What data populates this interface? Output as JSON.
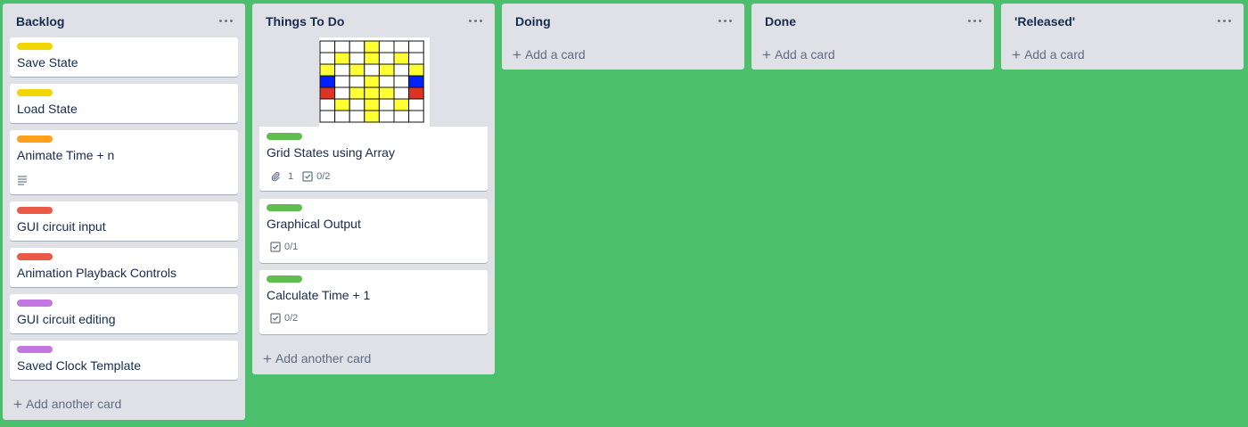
{
  "colors": {
    "board_bg": "#4bbf6b",
    "yellow": "#f2d600",
    "orange": "#ff9f1a",
    "red": "#eb5a46",
    "purple": "#c377e0",
    "green": "#61bd4f"
  },
  "lists": [
    {
      "title": "Backlog",
      "cards": [
        {
          "label_color": "yellow",
          "title": "Save State"
        },
        {
          "label_color": "yellow",
          "title": "Load State"
        },
        {
          "label_color": "orange",
          "title": "Animate Time + n",
          "has_description": true
        },
        {
          "label_color": "red",
          "title": "GUI circuit input"
        },
        {
          "label_color": "red",
          "title": "Animation Playback Controls"
        },
        {
          "label_color": "purple",
          "title": "GUI circuit editing"
        },
        {
          "label_color": "purple",
          "title": "Saved Clock Template"
        }
      ],
      "add_label": "Add another card"
    },
    {
      "title": "Things To Do",
      "cards": [
        {
          "label_color": "green",
          "title": "Grid States using Array",
          "attachments": "1",
          "checklist": "0/2",
          "has_cover": true
        },
        {
          "label_color": "green",
          "title": "Graphical Output",
          "checklist": "0/1"
        },
        {
          "label_color": "green",
          "title": "Calculate Time + 1",
          "checklist": "0/2"
        }
      ],
      "add_label": "Add another card"
    },
    {
      "title": "Doing",
      "cards": [],
      "add_label": "Add a card"
    },
    {
      "title": "Done",
      "cards": [],
      "add_label": "Add a card"
    },
    {
      "title": "'Released'",
      "cards": [],
      "add_label": "Add a card"
    }
  ],
  "cover_grid": {
    "colors": {
      "w": "#ffffff",
      "y": "#ffff33",
      "b": "#0022ff",
      "r": "#dd3322"
    },
    "rows": [
      "wwwywww",
      "wywywyw",
      "ywywywy",
      "bwwywwb",
      "rwyyywr",
      "wywywyw",
      "wwwywww"
    ]
  }
}
